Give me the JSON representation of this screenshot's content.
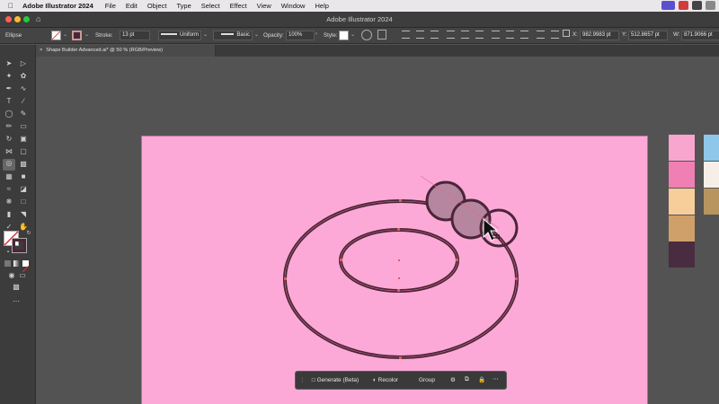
{
  "menubar": {
    "app_name": "Adobe Illustrator 2024",
    "items": [
      "File",
      "Edit",
      "Object",
      "Type",
      "Select",
      "Effect",
      "View",
      "Window",
      "Help"
    ]
  },
  "window": {
    "title": "Adobe Illustrator 2024"
  },
  "control_bar": {
    "shape_label": "Ellipse",
    "stroke_label": "Stroke:",
    "stroke_weight": "13 pt",
    "profile": "Uniform",
    "brush": "Basic",
    "opacity_label": "Opacity:",
    "opacity": "100%",
    "style_label": "Style:",
    "x_value": "982.9983 pt",
    "y_value": "512.8657 pt",
    "w_value": "871.9066 pt"
  },
  "document_tab": {
    "title": "Shape Builder Advanced.ai* @ 50 % (RGB/Preview)"
  },
  "swatches": [
    "#f8a6cd",
    "#f07fb3",
    "#f7cd9a",
    "#d0a06a",
    "#4a2c40",
    "#8ec7ea",
    "#f6efe8",
    "#b8955f"
  ],
  "contextual_bar": {
    "generate_label": "Generate (Beta)",
    "recolor_label": "Recolor",
    "group_label": "Group"
  },
  "colors": {
    "artboard": "#fca9d8",
    "stroke": "#4a2638",
    "accent_anchor": "#e05a5a"
  }
}
